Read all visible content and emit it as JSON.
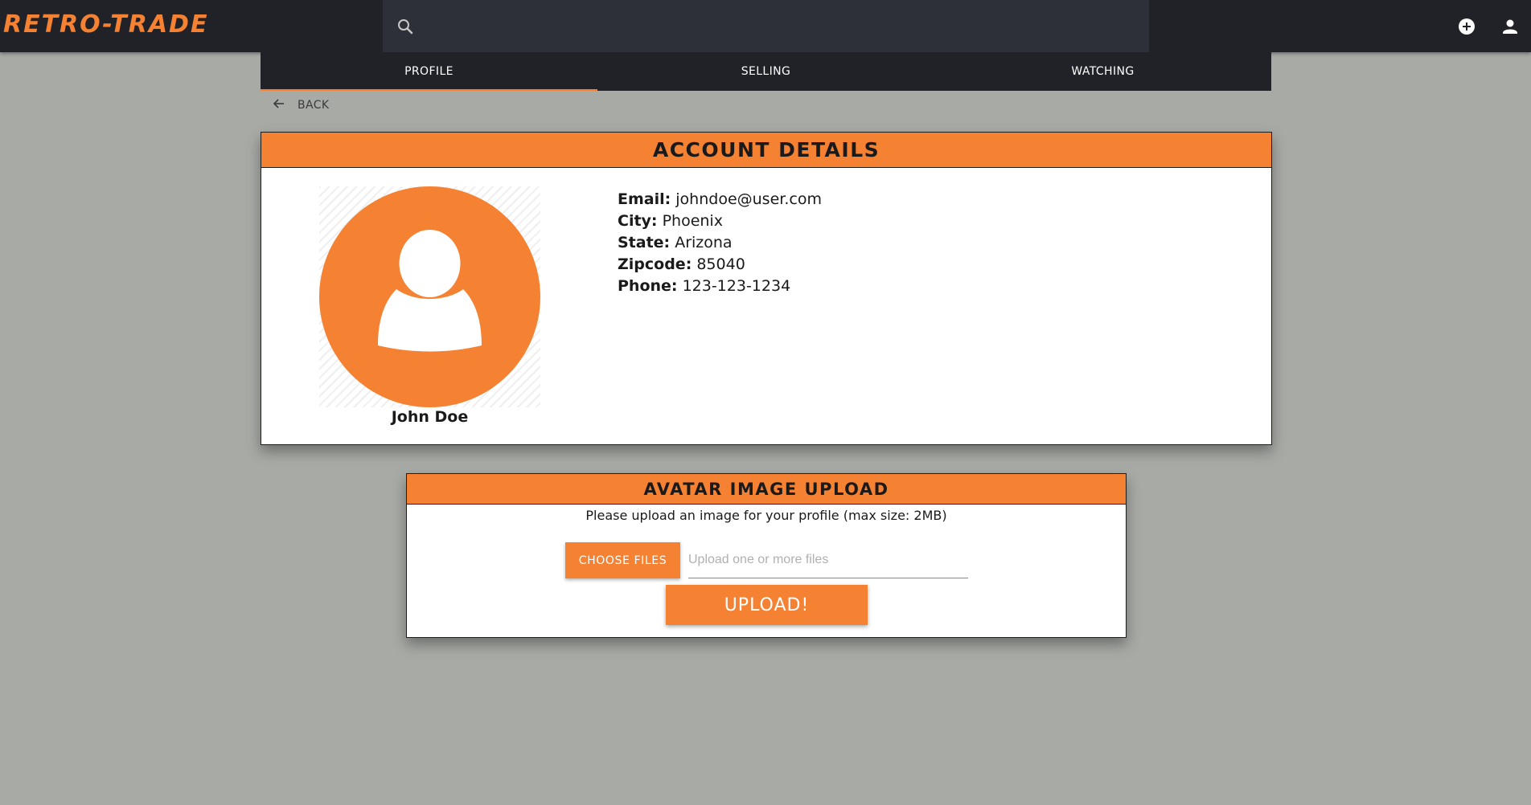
{
  "app": {
    "logo": "RETRO-TRADE",
    "search": {
      "value": "",
      "icon": "search-icon"
    },
    "actions": [
      {
        "name": "add-circle-icon"
      },
      {
        "name": "person-icon"
      }
    ]
  },
  "tabs": [
    {
      "label": "PROFILE",
      "active": true
    },
    {
      "label": "SELLING",
      "active": false
    },
    {
      "label": "WATCHING",
      "active": false
    }
  ],
  "back": {
    "label": "BACK",
    "icon": "arrow-left-icon"
  },
  "account": {
    "title": "Account Details",
    "avatar": "person-avatar-icon",
    "name": "John Doe",
    "details": [
      {
        "key": "Email:",
        "value": "johndoe@user.com"
      },
      {
        "key": "City:",
        "value": "Phoenix"
      },
      {
        "key": "State:",
        "value": "Arizona"
      },
      {
        "key": "Zipcode:",
        "value": "85040"
      },
      {
        "key": "Phone:",
        "value": "123-123-1234"
      }
    ]
  },
  "upload": {
    "title": "Avatar Image Upload",
    "note": "Please upload an image for your profile (max size: 2MB)",
    "choose_label": "CHOOSE FILES",
    "file_placeholder": "Upload one or more files",
    "submit_label": "UPLOAD!"
  },
  "colors": {
    "accent": "#f58233",
    "topbar": "#202228",
    "search": "#2d3038",
    "background": "#a8aaa6"
  }
}
